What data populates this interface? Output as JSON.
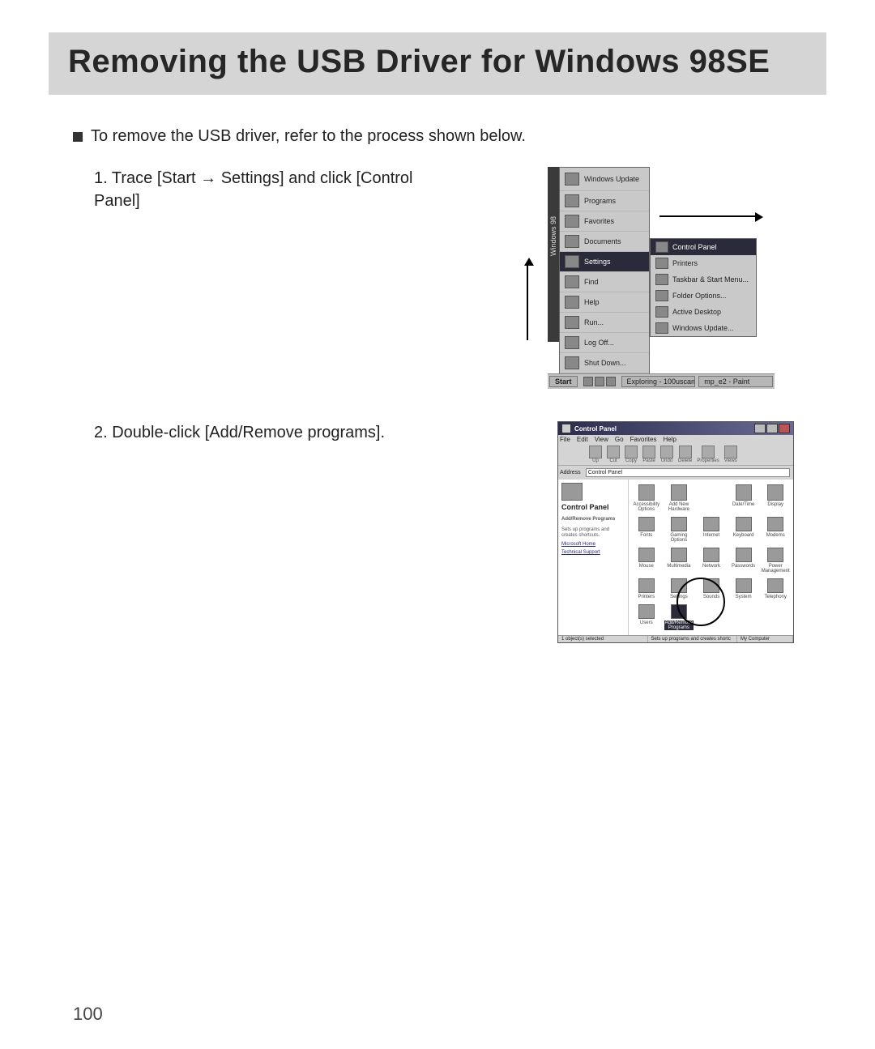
{
  "title": "Removing the USB Driver for Windows 98SE",
  "intro": "To remove the USB driver, refer to the process shown below.",
  "steps": [
    "1. Trace [Start → Settings] and click [Control Panel]",
    "2. Double-click [Add/Remove programs]."
  ],
  "page_number": "100",
  "fig1": {
    "vert_label": "Windows 98",
    "menu": [
      "Windows Update",
      "Programs",
      "Favorites",
      "Documents",
      "Settings",
      "Find",
      "Help",
      "Run...",
      "Log Off...",
      "Shut Down..."
    ],
    "submenu": [
      "Control Panel",
      "Printers",
      "Taskbar & Start Menu...",
      "Folder Options...",
      "Active Desktop",
      "Windows Update..."
    ],
    "taskbar": {
      "start": "Start",
      "tasks": [
        "Exploring - 100uscam",
        "mp_e2 - Paint"
      ]
    }
  },
  "fig2": {
    "title": "Control Panel",
    "menus": [
      "File",
      "Edit",
      "View",
      "Go",
      "Favorites",
      "Help"
    ],
    "tb_buttons": [
      "Up",
      "Cut",
      "Copy",
      "Paste",
      "Undo",
      "Delete",
      "Properties",
      "Views"
    ],
    "address_label": "Address",
    "address_value": "Control Panel",
    "side": {
      "title": "Control Panel",
      "sel_title": "Add/Remove Programs",
      "sel_desc": "Sets up programs and creates shortcuts.",
      "links": [
        "Microsoft Home",
        "Technical Support"
      ]
    },
    "icons": [
      "Accessibility Options",
      "Add New Hardware",
      "",
      "Date/Time",
      "Display",
      "Fonts",
      "Gaming Options",
      "Internet",
      "Keyboard",
      "Modems",
      "Mouse",
      "Multimedia",
      "Network",
      "Passwords",
      "Power Management",
      "Printers",
      "Settings",
      "Sounds",
      "System",
      "Telephony",
      "Users",
      "Add/Remove Programs"
    ],
    "status": [
      "1 object(s) selected",
      "Sets up programs and creates shortc",
      "My Computer"
    ]
  }
}
